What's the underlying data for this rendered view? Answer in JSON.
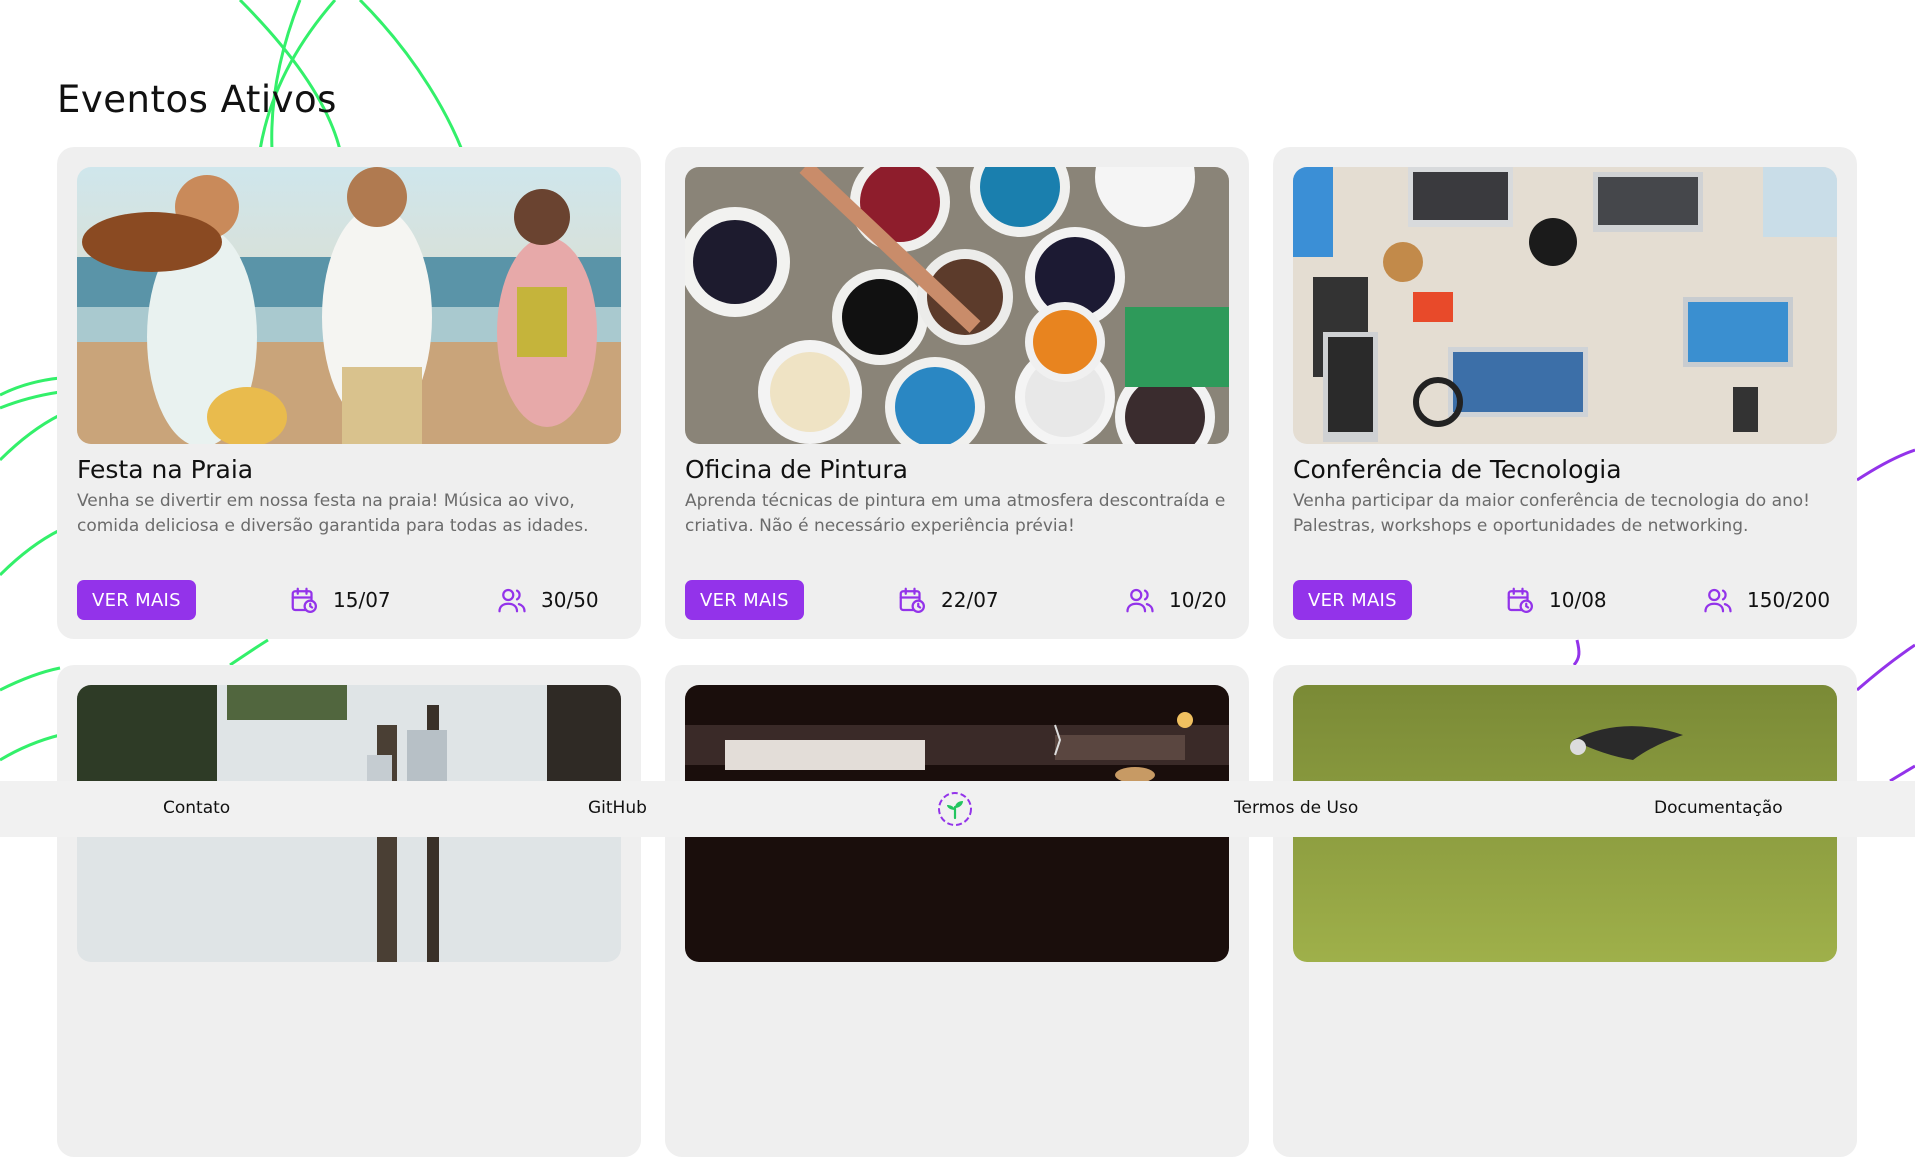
{
  "page": {
    "title": "Eventos Ativos"
  },
  "colors": {
    "accent": "#9333ea",
    "card_bg": "#efefef",
    "footer_bg": "#f1f1f1",
    "decor_green": "#22ee55",
    "decor_purple": "#9333ea"
  },
  "events": [
    {
      "title": "Festa na Praia",
      "description": "Venha se divertir em nossa festa na praia! Música ao vivo, comida deliciosa e diversão garantida para todas as idades.",
      "button": "VER MAIS",
      "date": "15/07",
      "participants": "30/50",
      "image": "beach-party-photo"
    },
    {
      "title": "Oficina de Pintura",
      "description": "Aprenda técnicas de pintura em uma atmosfera descontraída e criativa. Não é necessário experiência prévia!",
      "button": "VER MAIS",
      "date": "22/07",
      "participants": "10/20",
      "image": "paint-buckets-photo"
    },
    {
      "title": "Conferência de Tecnologia",
      "description": "Venha participar da maior conferência de tecnologia do ano! Palestras, workshops e oportunidades de networking.",
      "button": "VER MAIS",
      "date": "10/08",
      "participants": "150/200",
      "image": "tech-desk-photo"
    },
    {
      "title": "",
      "description": "",
      "image": "park-city-photo"
    },
    {
      "title": "",
      "description": "",
      "image": "stage-theater-photo"
    },
    {
      "title": "",
      "description": "",
      "image": "eagle-nature-photo"
    }
  ],
  "footer": {
    "links": [
      "Contato",
      "GitHub",
      "Termos de Uso",
      "Documentação"
    ],
    "logo": "sprout-logo-icon"
  }
}
